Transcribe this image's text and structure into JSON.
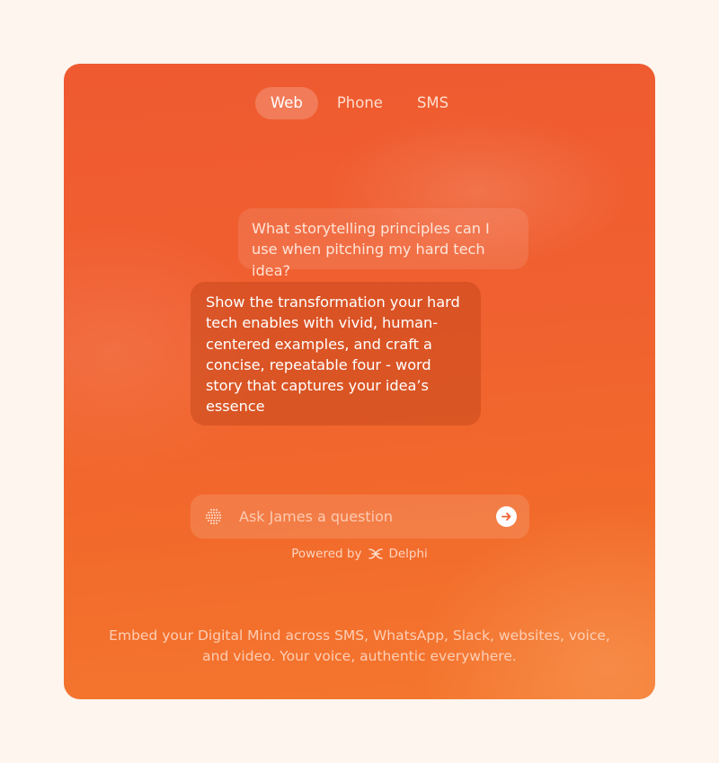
{
  "tabs": [
    {
      "label": "Web",
      "active": true
    },
    {
      "label": "Phone",
      "active": false
    },
    {
      "label": "SMS",
      "active": false
    }
  ],
  "chat": {
    "user_message": "What storytelling principles can I use when pitching my hard tech idea?",
    "bot_message": "Show the transformation your hard tech enables with vivid, human-centered examples, and craft a concise, repeatable four - word story that captures your idea’s essence"
  },
  "input": {
    "placeholder": "Ask James a question",
    "value": "",
    "icon": "dot-grid-icon",
    "send_icon": "arrow-right-icon"
  },
  "powered_by": {
    "prefix": "Powered by",
    "brand": "Delphi",
    "brand_icon": "delphi-logo-icon"
  },
  "footer": {
    "text": "Embed your Digital Mind across SMS, WhatsApp, Slack, websites, voice, and video. Your voice, authentic everywhere."
  },
  "colors": {
    "background": "#fdf5ee",
    "card_top": "#ef5a30",
    "card_bottom": "#f4772e",
    "send_button": "#ffffff",
    "send_arrow": "#f0622f"
  }
}
